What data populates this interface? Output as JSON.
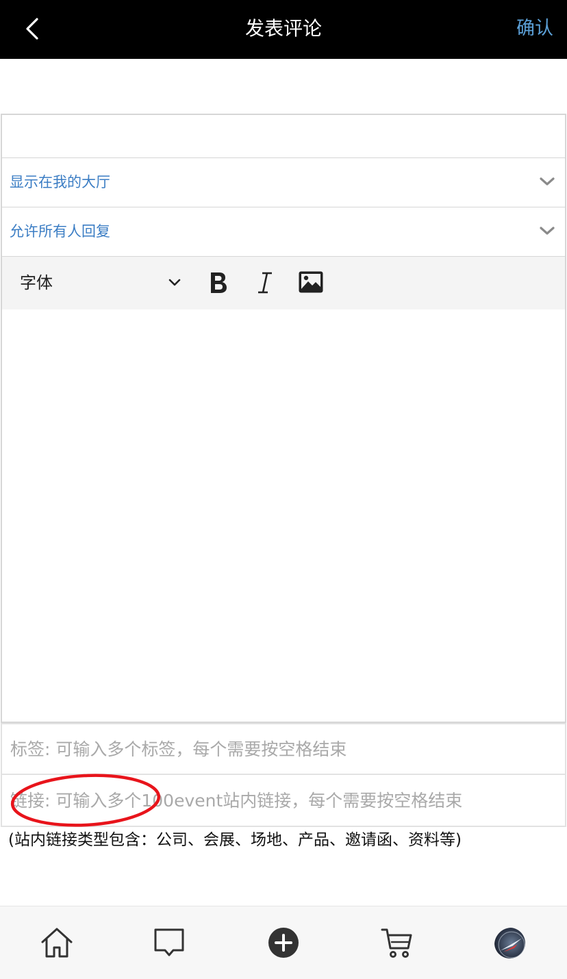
{
  "header": {
    "title": "发表评论",
    "confirm_label": "确认",
    "back_icon": "chevron-left-icon"
  },
  "form": {
    "title_input": {
      "value": "",
      "placeholder": ""
    },
    "visibility_select": {
      "selected": "显示在我的大厅"
    },
    "reply_select": {
      "selected": "允许所有人回复"
    },
    "toolbar": {
      "font_label": "字体",
      "bold_icon": "bold-icon",
      "italic_icon": "italic-icon",
      "image_icon": "image-icon"
    },
    "editor": {
      "value": ""
    },
    "tags_input": {
      "value": "",
      "placeholder": "标签: 可输入多个标签，每个需要按空格结束"
    },
    "links_input": {
      "value": "",
      "placeholder": "链接: 可输入多个100event站内链接，每个需要按空格结束"
    },
    "note": "(站内链接类型包含：公司、会展、场地、产品、邀请函、资料等)"
  },
  "annotation": {
    "shape": "ellipse",
    "color": "#e8141b"
  },
  "tabbar": {
    "items": [
      {
        "icon": "home-icon"
      },
      {
        "icon": "message-icon"
      },
      {
        "icon": "add-circle-icon"
      },
      {
        "icon": "cart-icon"
      },
      {
        "icon": "avatar"
      }
    ]
  },
  "colors": {
    "header_bg": "#000000",
    "accent_blue": "#5b9fd6",
    "link_blue": "#3b7dc4",
    "placeholder": "#a9a9a9",
    "annotation_red": "#e8141b"
  }
}
